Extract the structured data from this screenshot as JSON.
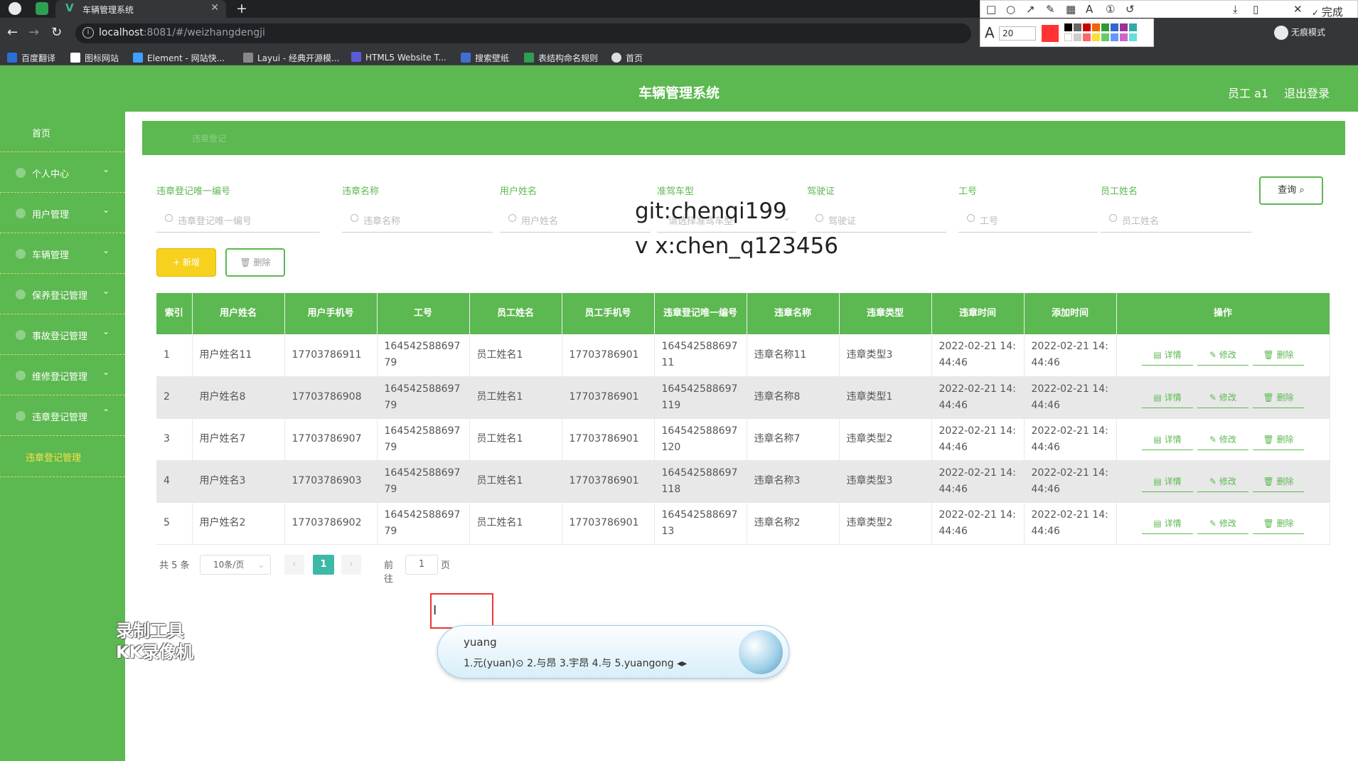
{
  "browser": {
    "tab_title": "车辆管理系统",
    "url_host": "localhost",
    "url_path": ":8081/#/weizhangdengji",
    "incognito_label": "无痕模式",
    "annotation_font_size": "20",
    "annotation_done": "完成",
    "bookmarks": [
      "百度翻译",
      "图标网站",
      "Element - 网站快...",
      "Layui - 经典开源模...",
      "HTML5 Website T...",
      "搜索壁纸",
      "表结构命名规则",
      "首页"
    ]
  },
  "header": {
    "title": "车辆管理系统",
    "user": "员工 a1",
    "logout": "退出登录"
  },
  "sidebar": {
    "items": [
      "首页",
      "个人中心",
      "用户管理",
      "车辆管理",
      "保养登记管理",
      "事故登记管理",
      "维修登记管理",
      "违章登记管理"
    ],
    "sub_item": "违章登记管理"
  },
  "breadcrumb": "违章登记",
  "filters": [
    {
      "label": "违章登记唯一编号",
      "placeholder": "违章登记唯一编号"
    },
    {
      "label": "违章名称",
      "placeholder": "违章名称"
    },
    {
      "label": "用户姓名",
      "placeholder": "用户姓名"
    },
    {
      "label": "准驾车型",
      "placeholder": "请选择准驾车型"
    },
    {
      "label": "驾驶证",
      "placeholder": "驾驶证"
    },
    {
      "label": "工号",
      "placeholder": "工号"
    },
    {
      "label": "员工姓名",
      "placeholder": "员工姓名"
    }
  ],
  "buttons": {
    "query": "查询",
    "add": "+ 新增",
    "delete": "删除"
  },
  "watermark": [
    "git:chenqi199",
    "v x:chen_q123456"
  ],
  "table": {
    "columns": [
      "索引",
      "用户姓名",
      "用户手机号",
      "工号",
      "员工姓名",
      "员工手机号",
      "违章登记唯一编号",
      "违章名称",
      "违章类型",
      "违章时间",
      "添加时间",
      "操作"
    ],
    "rows": [
      [
        "1",
        "用户姓名11",
        "17703786911",
        "16454258869779",
        "员工姓名1",
        "17703786901",
        "16454258869711",
        "违章名称11",
        "违章类型3",
        "2022-02-21 14:44:46",
        "2022-02-21 14:44:46"
      ],
      [
        "2",
        "用户姓名8",
        "17703786908",
        "16454258869779",
        "员工姓名1",
        "17703786901",
        "164542588697119",
        "违章名称8",
        "违章类型1",
        "2022-02-21 14:44:46",
        "2022-02-21 14:44:46"
      ],
      [
        "3",
        "用户姓名7",
        "17703786907",
        "16454258869779",
        "员工姓名1",
        "17703786901",
        "164542588697120",
        "违章名称7",
        "违章类型2",
        "2022-02-21 14:44:46",
        "2022-02-21 14:44:46"
      ],
      [
        "4",
        "用户姓名3",
        "17703786903",
        "16454258869779",
        "员工姓名1",
        "17703786901",
        "164542588697118",
        "违章名称3",
        "违章类型3",
        "2022-02-21 14:44:46",
        "2022-02-21 14:44:46"
      ],
      [
        "5",
        "用户姓名2",
        "17703786902",
        "16454258869779",
        "员工姓名1",
        "17703786901",
        "16454258869713",
        "违章名称2",
        "违章类型2",
        "2022-02-21 14:44:46",
        "2022-02-21 14:44:46"
      ]
    ],
    "actions": [
      "详情",
      "修改",
      "删除"
    ]
  },
  "pager": {
    "total": "共 5 条",
    "page_size": "10条/页",
    "current": "1",
    "goto": "前往",
    "jump_value": "1",
    "page_suffix": "页"
  },
  "ime": {
    "composition": "yuang",
    "candidates": "1.元(yuan)⊙   2.与昂   3.宇昂   4.与   5.yuangong"
  },
  "recorder": [
    "录制工具",
    "KK录像机"
  ],
  "colors": {
    "primary": "#5cb850",
    "accent": "#f6d21f",
    "pager_active": "#3eb8a7"
  }
}
